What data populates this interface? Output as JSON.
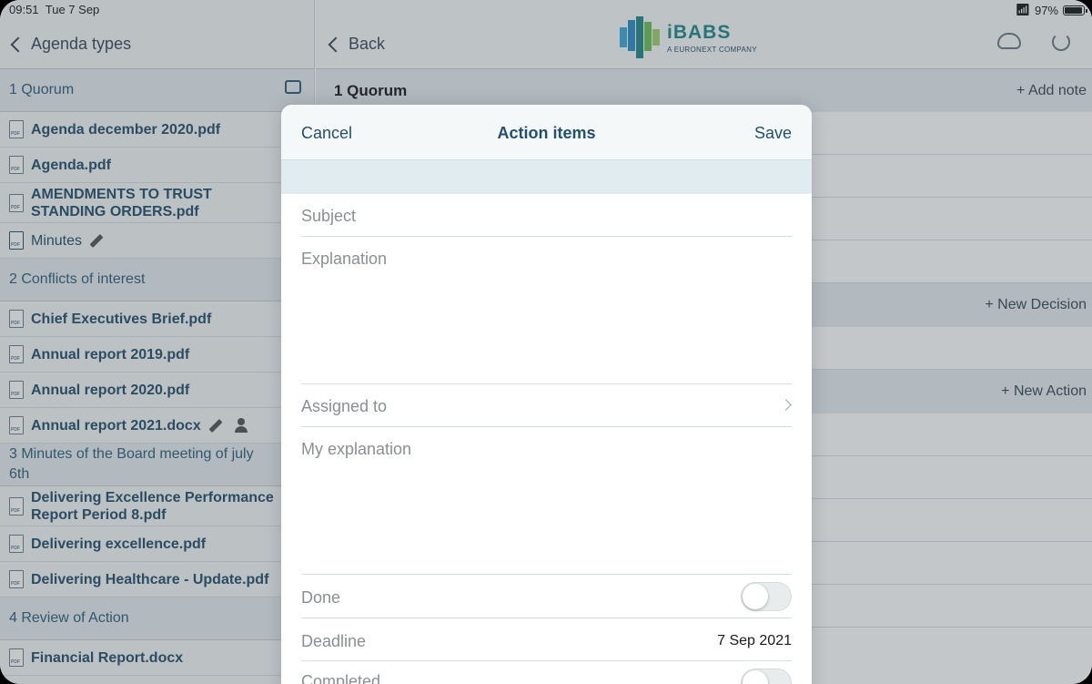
{
  "status": {
    "time": "09:51",
    "date": "Tue 7 Sep",
    "battery": "97%",
    "battery_level": 0.97
  },
  "sidebar": {
    "back_label": "Agenda types",
    "sections": [
      {
        "title": "1 Quorum",
        "items": [
          "Agenda december 2020.pdf",
          "Agenda.pdf",
          "AMENDMENTS TO TRUST STANDING ORDERS.pdf",
          "Minutes"
        ]
      },
      {
        "title": "2 Conflicts of interest",
        "items": [
          "Chief Executives Brief.pdf",
          "Annual report 2019.pdf",
          "Annual report 2020.pdf",
          "Annual report 2021.docx"
        ]
      },
      {
        "title": "3 Minutes of the Board meeting of july 6th",
        "items": [
          "Delivering Excellence Performance Report Period 8.pdf",
          "Delivering excellence.pdf",
          "Delivering Healthcare - Update.pdf"
        ]
      },
      {
        "title": "4 Review of Action",
        "items": [
          "Financial Report.docx"
        ]
      }
    ]
  },
  "main": {
    "back_label": "Back",
    "logo": {
      "name": "iBABS",
      "tagline": "A EURONEXT COMPANY"
    },
    "section_title": "1 Quorum",
    "add_note": "+ Add note",
    "new_decision": "+ New Decision",
    "new_action": "+ New Action"
  },
  "modal": {
    "cancel": "Cancel",
    "title": "Action items",
    "save": "Save",
    "subject": "Subject",
    "explanation": "Explanation",
    "assigned_to": "Assigned to",
    "my_explanation": "My explanation",
    "done": "Done",
    "deadline": "Deadline",
    "deadline_value": "7 Sep 2021",
    "completed": "Completed"
  }
}
